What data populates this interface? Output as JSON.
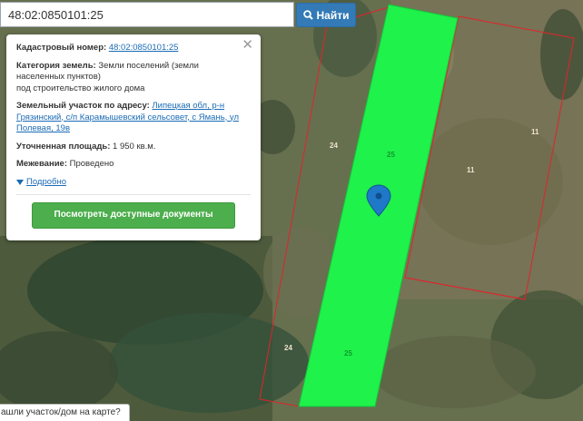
{
  "search": {
    "value": "48:02:0850101:25",
    "button_label": "Найти"
  },
  "popup": {
    "cadastral_label": "Кадастровый номер:",
    "cadastral_value": "48:02:0850101:25",
    "category_label": "Категория земель:",
    "category_value_line1": "Земли поселений (земли",
    "category_value_line2": "населенных пунктов)",
    "category_value_line3": "под строительство жилого дома",
    "address_label": "Земельный участок по адресу:",
    "address_line1": "Липецкая обл, р-н",
    "address_line2": "Грязинский, с/п Карамышевский сельсовет, с Ямань, ул",
    "address_line3": "Полевая, 19в",
    "area_label": "Уточненная площадь:",
    "area_value": "1 950 кв.м.",
    "survey_label": "Межевание:",
    "survey_value": "Проведено",
    "details_label": "Подробно",
    "docs_button": "Посмотреть доступные документы"
  },
  "map": {
    "plot_labels": [
      "24",
      "25",
      "11",
      "11",
      "24",
      "25"
    ],
    "selected_color": "#1ff24a",
    "boundary_color": "#e0242c",
    "marker_color": "#1f78c8"
  },
  "bottom_tip": "ашли участок/дом на карте?"
}
